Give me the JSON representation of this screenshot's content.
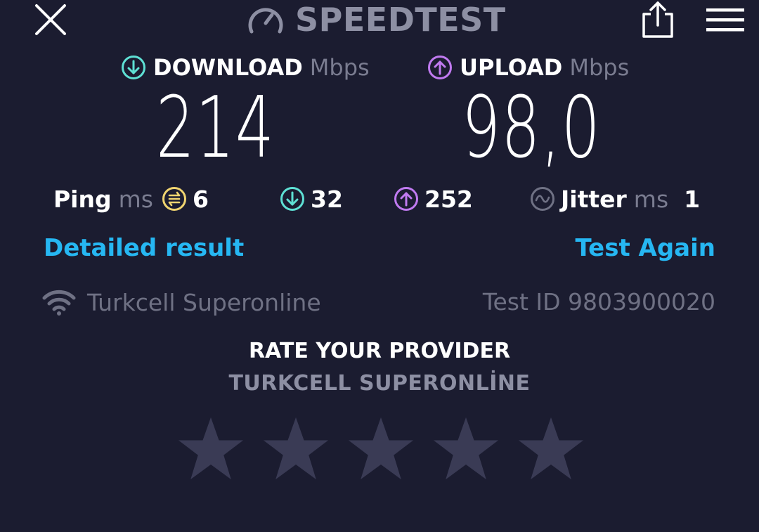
{
  "header": {
    "brand": "SPEEDTEST",
    "close_icon": "close-icon",
    "share_icon": "share-icon",
    "menu_icon": "hamburger-menu-icon"
  },
  "download": {
    "label": "DOWNLOAD",
    "unit": "Mbps",
    "value": "214",
    "color": "#5ee0d4"
  },
  "upload": {
    "label": "UPLOAD",
    "unit": "Mbps",
    "value": "98,0",
    "color": "#c07af0"
  },
  "stats": {
    "ping_label": "Ping",
    "ping_unit": "ms",
    "ping_value": "6",
    "ping_color": "#f0d470",
    "download_latency": "32",
    "upload_latency": "252",
    "jitter_label": "Jitter",
    "jitter_unit": "ms",
    "jitter_value": "1"
  },
  "links": {
    "detailed_result": "Detailed result",
    "test_again": "Test Again",
    "color": "#26b7f2"
  },
  "provider": {
    "name": "Turkcell Superonline",
    "test_id": "Test ID 9803900020"
  },
  "rating": {
    "title": "RATE YOUR PROVIDER",
    "provider_name": "TURKCELL SUPERONLİNE",
    "stars": 5,
    "selected": 0
  }
}
